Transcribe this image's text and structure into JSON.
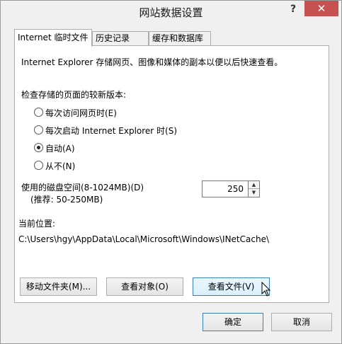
{
  "window": {
    "title": "网站数据设置",
    "help_glyph": "?",
    "close_glyph": "✕"
  },
  "tabs": [
    {
      "label": "Internet 临时文件",
      "active": true
    },
    {
      "label": "历史记录",
      "active": false
    },
    {
      "label": "缓存和数据库",
      "active": false
    }
  ],
  "panel": {
    "description": "Internet Explorer 存储网页、图像和媒体的副本以便以后快速查看。",
    "check_heading": "检查存储的页面的较新版本:",
    "options": [
      {
        "label": "每次访问网页时(E)",
        "checked": false
      },
      {
        "label": "每次启动 Internet Explorer 时(S)",
        "checked": false
      },
      {
        "label": "自动(A)",
        "checked": true
      },
      {
        "label": "从不(N)",
        "checked": false
      }
    ],
    "disk_space_label": "使用的磁盘空间(8-1024MB)(D)",
    "disk_space_hint": "(推荐: 50-250MB)",
    "disk_space_value": "250",
    "location_label": "当前位置:",
    "location_path": "C:\\Users\\hgy\\AppData\\Local\\Microsoft\\Windows\\INetCache\\",
    "buttons": {
      "move_folder": "移动文件夹(M)...",
      "view_objects": "查看对象(O)",
      "view_files": "查看文件(V)"
    }
  },
  "footer": {
    "ok_label": "确定",
    "cancel_label": "取消"
  },
  "colors": {
    "close_button": "#c75050",
    "hover_border": "#3c7fb1"
  }
}
